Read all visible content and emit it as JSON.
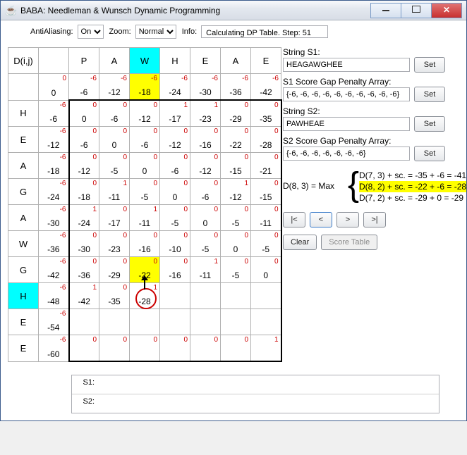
{
  "window": {
    "title": "BABA: Needleman & Wunsch Dynamic Programming"
  },
  "toolbar": {
    "antialias_label": "AntiAliasing:",
    "antialias_value": "On",
    "zoom_label": "Zoom:",
    "zoom_value": "Normal",
    "info_label": "Info:",
    "info_value": "Calculating DP Table. Step: 51"
  },
  "grid": {
    "corner_label": "D(i,j)",
    "col_headers": [
      "",
      "P",
      "A",
      "W",
      "H",
      "E",
      "A",
      "E"
    ],
    "row_headers": [
      "",
      "H",
      "E",
      "A",
      "G",
      "A",
      "W",
      "G",
      "H",
      "E",
      "E"
    ],
    "cells": [
      [
        {
          "v": "0",
          "s": "0"
        },
        {
          "v": "-6",
          "s": "-6"
        },
        {
          "v": "-12",
          "s": "-6"
        },
        {
          "v": "-18",
          "s": "-6"
        },
        {
          "v": "-24",
          "s": "-6"
        },
        {
          "v": "-30",
          "s": "-6"
        },
        {
          "v": "-36",
          "s": "-6"
        },
        {
          "v": "-42",
          "s": "-6"
        }
      ],
      [
        {
          "v": "-6",
          "s": "-6"
        },
        {
          "v": "0",
          "s": "0"
        },
        {
          "v": "-6",
          "s": "0"
        },
        {
          "v": "-12",
          "s": "0"
        },
        {
          "v": "-17",
          "s": "1"
        },
        {
          "v": "-23",
          "s": "1"
        },
        {
          "v": "-29",
          "s": "0"
        },
        {
          "v": "-35",
          "s": "0"
        }
      ],
      [
        {
          "v": "-12",
          "s": "-6"
        },
        {
          "v": "-6",
          "s": "0"
        },
        {
          "v": "0",
          "s": "0"
        },
        {
          "v": "-6",
          "s": "0"
        },
        {
          "v": "-12",
          "s": "0"
        },
        {
          "v": "-16",
          "s": "0"
        },
        {
          "v": "-22",
          "s": "0"
        },
        {
          "v": "-28",
          "s": "0"
        }
      ],
      [
        {
          "v": "-18",
          "s": "-6"
        },
        {
          "v": "-12",
          "s": "0"
        },
        {
          "v": "-5",
          "s": "0"
        },
        {
          "v": "0",
          "s": "0"
        },
        {
          "v": "-6",
          "s": "0"
        },
        {
          "v": "-12",
          "s": "0"
        },
        {
          "v": "-15",
          "s": "0"
        },
        {
          "v": "-21",
          "s": "0"
        }
      ],
      [
        {
          "v": "-24",
          "s": "-6"
        },
        {
          "v": "-18",
          "s": "0"
        },
        {
          "v": "-11",
          "s": "1"
        },
        {
          "v": "-5",
          "s": "0"
        },
        {
          "v": "0",
          "s": "0"
        },
        {
          "v": "-6",
          "s": "0"
        },
        {
          "v": "-12",
          "s": "1"
        },
        {
          "v": "-15",
          "s": "0"
        }
      ],
      [
        {
          "v": "-30",
          "s": "-6"
        },
        {
          "v": "-24",
          "s": "1"
        },
        {
          "v": "-17",
          "s": "0"
        },
        {
          "v": "-11",
          "s": "1"
        },
        {
          "v": "-5",
          "s": "0"
        },
        {
          "v": "0",
          "s": "0"
        },
        {
          "v": "-5",
          "s": "0"
        },
        {
          "v": "-11",
          "s": "0"
        }
      ],
      [
        {
          "v": "-36",
          "s": "-6"
        },
        {
          "v": "-30",
          "s": "0"
        },
        {
          "v": "-23",
          "s": "0"
        },
        {
          "v": "-16",
          "s": "0"
        },
        {
          "v": "-10",
          "s": "0"
        },
        {
          "v": "-5",
          "s": "0"
        },
        {
          "v": "0",
          "s": "0"
        },
        {
          "v": "-5",
          "s": "0"
        }
      ],
      [
        {
          "v": "-42",
          "s": "-6"
        },
        {
          "v": "-36",
          "s": "0"
        },
        {
          "v": "-29",
          "s": "0"
        },
        {
          "v": "-22",
          "s": "0"
        },
        {
          "v": "-16",
          "s": "0"
        },
        {
          "v": "-11",
          "s": "1"
        },
        {
          "v": "-5",
          "s": "0"
        },
        {
          "v": "0",
          "s": "0"
        }
      ],
      [
        {
          "v": "-48",
          "s": "-6"
        },
        {
          "v": "-42",
          "s": "1"
        },
        {
          "v": "-35",
          "s": "0"
        },
        {
          "v": "-28",
          "s": "1"
        },
        {
          "v": "",
          "s": ""
        },
        {
          "v": "",
          "s": ""
        },
        {
          "v": "",
          "s": ""
        },
        {
          "v": "",
          "s": ""
        }
      ],
      [
        {
          "v": "-54",
          "s": "-6"
        },
        {
          "v": "",
          "s": ""
        },
        {
          "v": "",
          "s": ""
        },
        {
          "v": "",
          "s": ""
        },
        {
          "v": "",
          "s": ""
        },
        {
          "v": "",
          "s": ""
        },
        {
          "v": "",
          "s": ""
        },
        {
          "v": "",
          "s": ""
        }
      ],
      [
        {
          "v": "-60",
          "s": "-6"
        },
        {
          "v": "",
          "s": "0"
        },
        {
          "v": "",
          "s": "0"
        },
        {
          "v": "",
          "s": "0"
        },
        {
          "v": "",
          "s": "0"
        },
        {
          "v": "",
          "s": "0"
        },
        {
          "v": "",
          "s": "0"
        },
        {
          "v": "",
          "s": "1"
        }
      ]
    ],
    "col_highlight_header_index": 3,
    "row_highlight_header_index": 8,
    "yellow_cells": [
      [
        0,
        3
      ],
      [
        7,
        3
      ]
    ],
    "circle_cell": [
      8,
      3
    ],
    "arrow_from": [
      8,
      3
    ],
    "darkbox": {
      "r0": 1,
      "c0": 1,
      "r1": 10,
      "c1": 7
    }
  },
  "right": {
    "s1_label": "String S1:",
    "s1_value": "HEAGAWGHEE",
    "s1gap_label": "S1 Score Gap Penalty Array:",
    "s1gap_value": "{-6, -6, -6, -6, -6, -6, -6, -6, -6, -6}",
    "s2_label": "String S2:",
    "s2_value": "PAWHEAE",
    "s2gap_label": "S2 Score Gap Penalty Array:",
    "s2gap_value": "{-6, -6, -6, -6, -6, -6, -6}",
    "set_label": "Set",
    "formula_lhs": "D(8, 3) = Max",
    "formula_opt1": "D(7, 3) + sc. = -35 + -6 = -41",
    "formula_opt2": "D(8, 2) + sc. = -22 + -6 = -28",
    "formula_opt3": "D(7, 2) + sc. = -29 + 0 = -29",
    "nav_first": "|<",
    "nav_prev": "<",
    "nav_next": ">",
    "nav_last": ">|",
    "clear_label": "Clear",
    "score_label": "Score Table"
  },
  "bottom": {
    "s1_label": "S1:",
    "s2_label": "S2:",
    "s1_value": "",
    "s2_value": ""
  }
}
